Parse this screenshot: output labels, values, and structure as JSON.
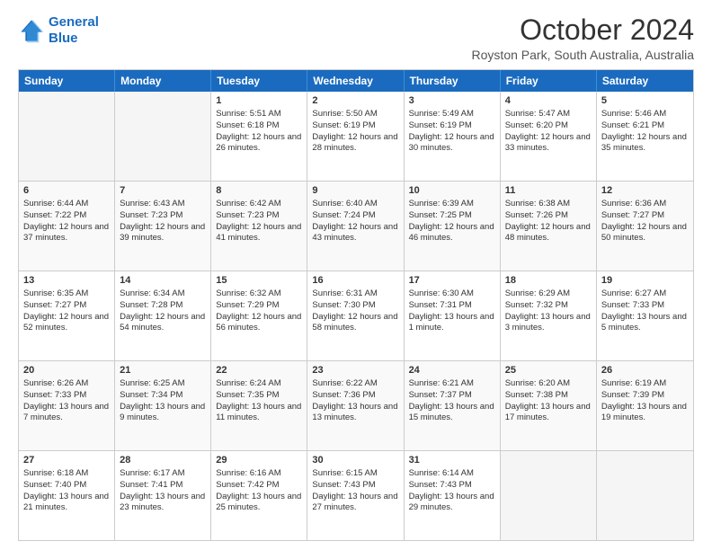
{
  "logo": {
    "line1": "General",
    "line2": "Blue"
  },
  "header": {
    "month": "October 2024",
    "location": "Royston Park, South Australia, Australia"
  },
  "weekdays": [
    "Sunday",
    "Monday",
    "Tuesday",
    "Wednesday",
    "Thursday",
    "Friday",
    "Saturday"
  ],
  "rows": [
    [
      {
        "day": "",
        "info": "",
        "empty": true
      },
      {
        "day": "",
        "info": "",
        "empty": true
      },
      {
        "day": "1",
        "info": "Sunrise: 5:51 AM\nSunset: 6:18 PM\nDaylight: 12 hours and 26 minutes."
      },
      {
        "day": "2",
        "info": "Sunrise: 5:50 AM\nSunset: 6:19 PM\nDaylight: 12 hours and 28 minutes."
      },
      {
        "day": "3",
        "info": "Sunrise: 5:49 AM\nSunset: 6:19 PM\nDaylight: 12 hours and 30 minutes."
      },
      {
        "day": "4",
        "info": "Sunrise: 5:47 AM\nSunset: 6:20 PM\nDaylight: 12 hours and 33 minutes."
      },
      {
        "day": "5",
        "info": "Sunrise: 5:46 AM\nSunset: 6:21 PM\nDaylight: 12 hours and 35 minutes."
      }
    ],
    [
      {
        "day": "6",
        "info": "Sunrise: 6:44 AM\nSunset: 7:22 PM\nDaylight: 12 hours and 37 minutes."
      },
      {
        "day": "7",
        "info": "Sunrise: 6:43 AM\nSunset: 7:23 PM\nDaylight: 12 hours and 39 minutes."
      },
      {
        "day": "8",
        "info": "Sunrise: 6:42 AM\nSunset: 7:23 PM\nDaylight: 12 hours and 41 minutes."
      },
      {
        "day": "9",
        "info": "Sunrise: 6:40 AM\nSunset: 7:24 PM\nDaylight: 12 hours and 43 minutes."
      },
      {
        "day": "10",
        "info": "Sunrise: 6:39 AM\nSunset: 7:25 PM\nDaylight: 12 hours and 46 minutes."
      },
      {
        "day": "11",
        "info": "Sunrise: 6:38 AM\nSunset: 7:26 PM\nDaylight: 12 hours and 48 minutes."
      },
      {
        "day": "12",
        "info": "Sunrise: 6:36 AM\nSunset: 7:27 PM\nDaylight: 12 hours and 50 minutes."
      }
    ],
    [
      {
        "day": "13",
        "info": "Sunrise: 6:35 AM\nSunset: 7:27 PM\nDaylight: 12 hours and 52 minutes."
      },
      {
        "day": "14",
        "info": "Sunrise: 6:34 AM\nSunset: 7:28 PM\nDaylight: 12 hours and 54 minutes."
      },
      {
        "day": "15",
        "info": "Sunrise: 6:32 AM\nSunset: 7:29 PM\nDaylight: 12 hours and 56 minutes."
      },
      {
        "day": "16",
        "info": "Sunrise: 6:31 AM\nSunset: 7:30 PM\nDaylight: 12 hours and 58 minutes."
      },
      {
        "day": "17",
        "info": "Sunrise: 6:30 AM\nSunset: 7:31 PM\nDaylight: 13 hours and 1 minute."
      },
      {
        "day": "18",
        "info": "Sunrise: 6:29 AM\nSunset: 7:32 PM\nDaylight: 13 hours and 3 minutes."
      },
      {
        "day": "19",
        "info": "Sunrise: 6:27 AM\nSunset: 7:33 PM\nDaylight: 13 hours and 5 minutes."
      }
    ],
    [
      {
        "day": "20",
        "info": "Sunrise: 6:26 AM\nSunset: 7:33 PM\nDaylight: 13 hours and 7 minutes."
      },
      {
        "day": "21",
        "info": "Sunrise: 6:25 AM\nSunset: 7:34 PM\nDaylight: 13 hours and 9 minutes."
      },
      {
        "day": "22",
        "info": "Sunrise: 6:24 AM\nSunset: 7:35 PM\nDaylight: 13 hours and 11 minutes."
      },
      {
        "day": "23",
        "info": "Sunrise: 6:22 AM\nSunset: 7:36 PM\nDaylight: 13 hours and 13 minutes."
      },
      {
        "day": "24",
        "info": "Sunrise: 6:21 AM\nSunset: 7:37 PM\nDaylight: 13 hours and 15 minutes."
      },
      {
        "day": "25",
        "info": "Sunrise: 6:20 AM\nSunset: 7:38 PM\nDaylight: 13 hours and 17 minutes."
      },
      {
        "day": "26",
        "info": "Sunrise: 6:19 AM\nSunset: 7:39 PM\nDaylight: 13 hours and 19 minutes."
      }
    ],
    [
      {
        "day": "27",
        "info": "Sunrise: 6:18 AM\nSunset: 7:40 PM\nDaylight: 13 hours and 21 minutes."
      },
      {
        "day": "28",
        "info": "Sunrise: 6:17 AM\nSunset: 7:41 PM\nDaylight: 13 hours and 23 minutes."
      },
      {
        "day": "29",
        "info": "Sunrise: 6:16 AM\nSunset: 7:42 PM\nDaylight: 13 hours and 25 minutes."
      },
      {
        "day": "30",
        "info": "Sunrise: 6:15 AM\nSunset: 7:43 PM\nDaylight: 13 hours and 27 minutes."
      },
      {
        "day": "31",
        "info": "Sunrise: 6:14 AM\nSunset: 7:43 PM\nDaylight: 13 hours and 29 minutes."
      },
      {
        "day": "",
        "info": "",
        "empty": true
      },
      {
        "day": "",
        "info": "",
        "empty": true
      }
    ]
  ]
}
